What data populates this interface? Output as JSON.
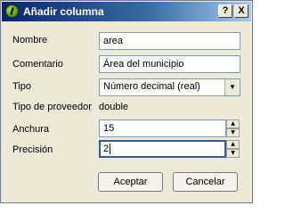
{
  "window": {
    "title": "Añadir columna",
    "help_label": "?",
    "close_label": "X",
    "app_icon": "qgis-icon"
  },
  "form": {
    "name": {
      "label": "Nombre",
      "value": "area"
    },
    "comment": {
      "label": "Comentario",
      "value": "Área del municipio"
    },
    "type": {
      "label": "Tipo",
      "value": "Número decimal (real)"
    },
    "provider_type": {
      "label": "Tipo de proveedor",
      "value": "double"
    },
    "width": {
      "label": "Anchura",
      "value": "15"
    },
    "precision": {
      "label": "Precisión",
      "value": "2"
    }
  },
  "buttons": {
    "ok": "Aceptar",
    "cancel": "Cancelar"
  },
  "colors": {
    "title_start": "#0a246a",
    "title_end": "#a6caf0",
    "window_bg": "#ece9d8",
    "focus_border": "#3c5a90"
  }
}
